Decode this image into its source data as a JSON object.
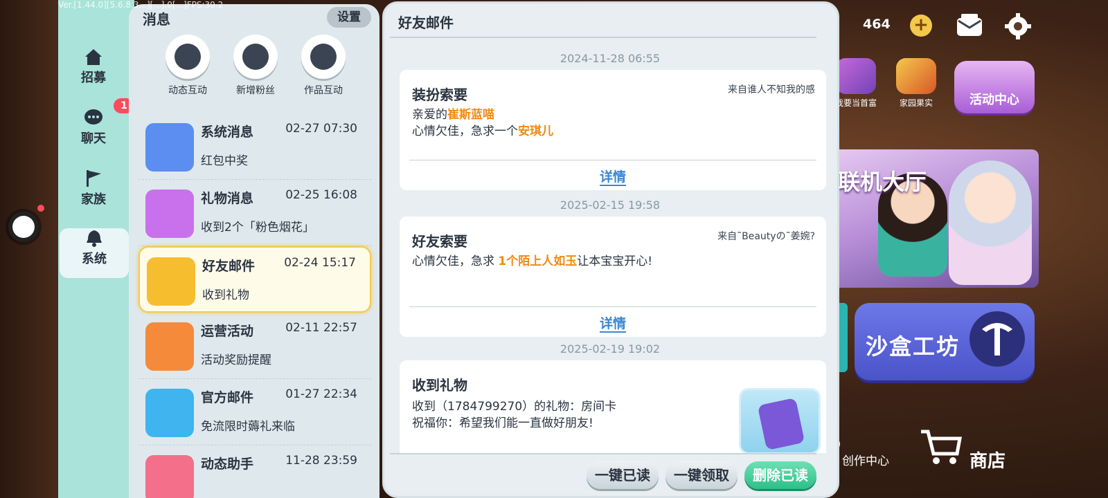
{
  "version_text": "Ver.[1.44.0][5.6.8.3...][...].0[...]FPS:30.2",
  "game": {
    "coin_count": "464",
    "plus_label": "+",
    "shortcuts": [
      {
        "label": "我要当首富"
      },
      {
        "label": "家园果实"
      }
    ],
    "activity_center": "活动中心",
    "hall_title": "联机大厅",
    "sandbox": "沙盒工坊",
    "create_center": "创作中心",
    "shop": "商店"
  },
  "nav": {
    "items": [
      {
        "label": "招募",
        "icon": "house-icon"
      },
      {
        "label": "聊天",
        "icon": "chat-bubble-icon"
      },
      {
        "label": "家族",
        "icon": "flag-icon"
      },
      {
        "label": "系统",
        "icon": "bell-icon"
      }
    ],
    "chat_badge": "1",
    "active": "系统"
  },
  "messages": {
    "title": "消息",
    "settings": "设置",
    "quick": [
      {
        "label": "动态互动",
        "icon": "star-bubble-icon"
      },
      {
        "label": "新增粉丝",
        "icon": "new-user-icon"
      },
      {
        "label": "作品互动",
        "icon": "list-icon"
      }
    ],
    "list": [
      {
        "title": "系统消息",
        "time": "02-27 07:30",
        "sub": "红包中奖",
        "color": "#5b8ef0",
        "icon": "gear-icon"
      },
      {
        "title": "礼物消息",
        "time": "02-25 16:08",
        "sub": "收到2个「粉色烟花」",
        "color": "#c971ec",
        "icon": "gift-icon"
      },
      {
        "title": "好友邮件",
        "time": "02-24 15:17",
        "sub": "收到礼物",
        "color": "#f6be2f",
        "icon": "friend-mail-icon"
      },
      {
        "title": "运营活动",
        "time": "02-11 22:57",
        "sub": "活动奖励提醒",
        "color": "#f58a3a",
        "icon": "megaphone-icon"
      },
      {
        "title": "官方邮件",
        "time": "01-27 22:34",
        "sub": "免流限时薅礼来临",
        "color": "#3fb4ef",
        "icon": "envelope-icon"
      },
      {
        "title": "动态助手",
        "time": "11-28 23:59",
        "sub": "",
        "color": "#f36f8a",
        "icon": "assistant-icon"
      }
    ]
  },
  "detail": {
    "title": "好友邮件",
    "mails": [
      {
        "timestamp": "2024-11-28 06:55",
        "title": "装扮索要",
        "from": "来自谁人不知我的感",
        "line1_a": "亲爱的",
        "line1_hl": "崔斯蓝喵",
        "line2_a": "心情欠佳，急求一个",
        "line2_hl": "安琪儿",
        "detail_link": "详情"
      },
      {
        "timestamp": "2025-02-15 19:58",
        "title": "好友索要",
        "from": "来自˜Beautyの˜姜婉?",
        "line1_a": "心情欠佳，急求 ",
        "line1_hl": "1个陌上人如玉",
        "line1_b": "让本宝宝开心!",
        "detail_link": "详情"
      },
      {
        "timestamp": "2025-02-19 19:02",
        "title": "收到礼物",
        "line1": "收到（1784799270）的礼物：房间卡",
        "line2": "祝福你：希望我们能一直做好朋友!"
      }
    ],
    "buttons": {
      "read_all": "一键已读",
      "claim_all": "一键领取",
      "delete_read": "删除已读"
    }
  }
}
